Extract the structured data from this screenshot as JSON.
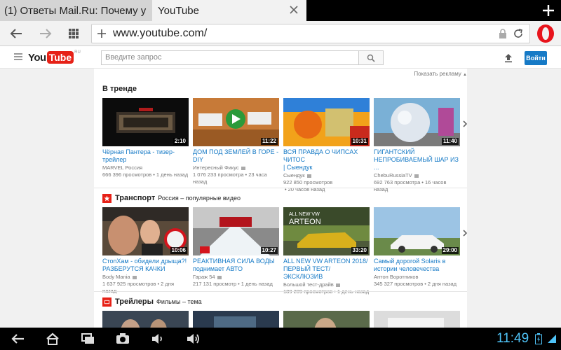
{
  "browser": {
    "tabs": [
      {
        "label": "(1) Ответы Mail.Ru: Почему у м",
        "active": false
      },
      {
        "label": "YouTube",
        "active": true
      }
    ],
    "url": "www.youtube.com/",
    "icons": [
      "back-icon",
      "forward-icon",
      "speed-dial-icon",
      "plus-icon",
      "lock-icon",
      "reload-icon",
      "opera-logo"
    ]
  },
  "youtube": {
    "logo": {
      "you": "You",
      "tube": "Tube",
      "region": "RU"
    },
    "search_placeholder": "Введите запрос",
    "signin_label": "Войти",
    "show_ads_label": "Показать рекламу",
    "colors": {
      "brand_red": "#e62117",
      "link_blue": "#167ac6",
      "signin_blue": "#167ac6"
    },
    "sections": [
      {
        "title": "В тренде",
        "subtitle": "",
        "videos": [
          {
            "title_line1": "Чёрная Пантера - тизер-",
            "title_line2": "трейлер",
            "channel": "MARVEL Россия",
            "verified": false,
            "views": "666 396 просмотров",
            "age": "1 день назад",
            "duration": "2:10"
          },
          {
            "title_line1": "ДОМ ПОД ЗЕМЛЕЙ В ГОРЕ - DIY",
            "title_line2": "",
            "channel": "Интересный Фикус",
            "verified": true,
            "views": "1 076 233 просмотра",
            "age": "23 часа назад",
            "duration": "11:22"
          },
          {
            "title_line1": "ВСЯ ПРАВДА О ЧИПСАХ ЧИТОС",
            "title_line2": "| Сыендук",
            "channel": "Сыендук",
            "verified": true,
            "views": "922 850 просмотров",
            "age": "20 часов назад",
            "duration": "10:31"
          },
          {
            "title_line1": "ГИГАНТСКИЙ",
            "title_line2": "НЕПРОБИВАЕМЫЙ ШАР ИЗ ...",
            "channel": "ChebuRussiaTV",
            "verified": true,
            "views": "692 763 просмотра",
            "age": "16 часов назад",
            "duration": "11:40"
          }
        ]
      },
      {
        "title": "Транспорт",
        "subtitle": "Россия – популярные видео",
        "videos": [
          {
            "title_line1": "СтопХам - обидели дрыща?!",
            "title_line2": "РАЗБЕРУТСЯ КАЧКИ",
            "channel": "Body Mania",
            "verified": true,
            "views": "1 637 925 просмотров",
            "age": "2 дня назад",
            "duration": "10:06"
          },
          {
            "title_line1": "РЕАКТИВНАЯ СИЛА ВОДЫ",
            "title_line2": "поднимает АВТО",
            "channel": "Гараж 54",
            "verified": true,
            "views": "217 131 просмотр",
            "age": "1 день назад",
            "duration": "10:27"
          },
          {
            "title_line1": "ALL NEW VW ARTEON 2018/",
            "title_line2": "ПЕРВЫЙ ТЕСТ/ЭКСКЛЮЗИВ",
            "channel": "Большой тест-драйв",
            "verified": true,
            "views": "189 209 просмотров",
            "age": "1 день назад",
            "duration": "33:20"
          },
          {
            "title_line1": "Самый дорогой Solaris в",
            "title_line2": "истории человечества",
            "channel": "Антон Воротников",
            "verified": false,
            "views": "345 327 просмотров",
            "age": "2 дня назад",
            "duration": "29:00"
          }
        ]
      },
      {
        "title": "Трейлеры",
        "subtitle": "Фильмы – тема",
        "videos": []
      }
    ]
  },
  "system": {
    "time": "11:49",
    "nav_icons": [
      "back-nav-icon",
      "home-nav-icon",
      "recents-nav-icon",
      "camera-icon",
      "volume-down-icon",
      "volume-up-icon"
    ]
  }
}
